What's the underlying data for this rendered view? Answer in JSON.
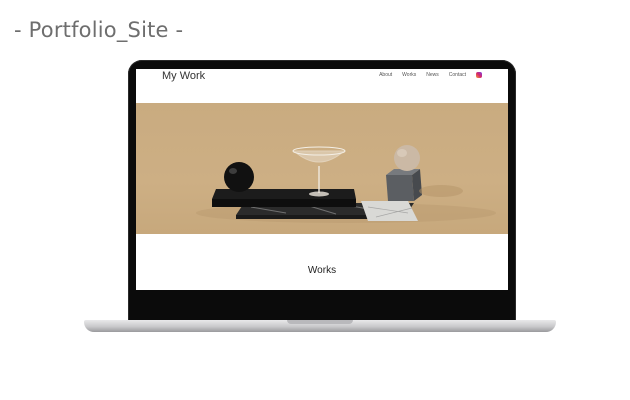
{
  "page": {
    "heading": "- Portfolio_Site -"
  },
  "site": {
    "logo": "My Work",
    "nav": [
      {
        "label": "About"
      },
      {
        "label": "Works"
      },
      {
        "label": "News"
      },
      {
        "label": "Contact"
      }
    ],
    "nav_icon": "instagram-icon",
    "section_title": "Works"
  },
  "colors": {
    "hero_background": "#c9ab80",
    "heading_text": "#6e6e6e",
    "laptop_bezel": "#0b0b0b"
  }
}
